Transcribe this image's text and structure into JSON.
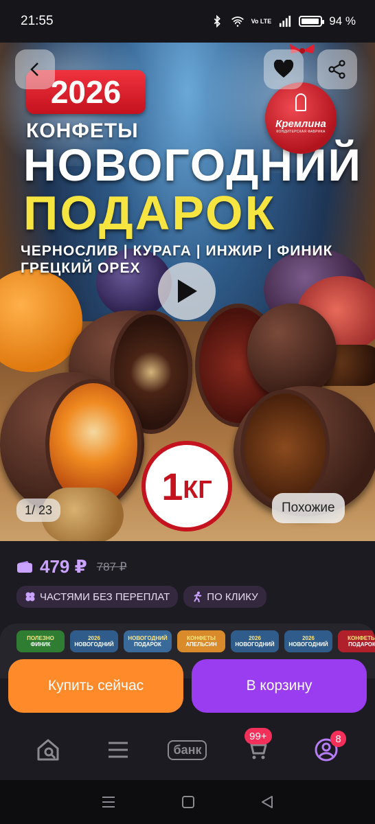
{
  "status_bar": {
    "time": "21:55",
    "network": "Vo LTE",
    "battery_pct": "94 %",
    "battery_level": 0.94
  },
  "hero": {
    "year": "2026",
    "subtitle": "КОНФЕТЫ",
    "title_line1": "НОВОГОДНИЙ",
    "title_line2": "ПОДАРОК",
    "ingredients_line1": "ЧЕРНОСЛИВ | КУРАГА | ИНЖИР | ФИНИК",
    "ingredients_line2": "ГРЕЦКИЙ ОРЕХ",
    "brand_name": "Кремлина",
    "brand_sub": "КОНДИТЕРСКАЯ ФАБРИКА",
    "weight_num": "1",
    "weight_unit": "КГ",
    "pager": "1/ 23",
    "similar_label": "Похожие",
    "icons": [
      "back-icon",
      "heart-icon",
      "share-icon",
      "play-icon"
    ]
  },
  "price": {
    "current": "479 ₽",
    "old": "787 ₽",
    "chips": [
      {
        "icon": "parts-icon",
        "label": "ЧАСТЯМИ БЕЗ ПЕРЕПЛАТ"
      },
      {
        "icon": "runner-icon",
        "label": "ПО КЛИКУ"
      }
    ]
  },
  "similar_thumbs": [
    {
      "line1": "ПОЛЕЗНО",
      "line2": "ФИНИК",
      "bg": "#2e7d32"
    },
    {
      "line1": "2026",
      "line2": "НОВОГОДНИЙ",
      "bg": "#2f5c8a"
    },
    {
      "line1": "НОВОГОДНИЙ",
      "line2": "ПОДАРОК",
      "bg": "#3a6a9a"
    },
    {
      "line1": "КОНФЕТЫ",
      "line2": "АПЕЛЬСИН",
      "bg": "#d98a2a"
    },
    {
      "line1": "2026",
      "line2": "НОВОГОДНИЙ",
      "bg": "#2f5c8a"
    },
    {
      "line1": "2026",
      "line2": "НОВОГОДНИЙ",
      "bg": "#2f5c8a"
    },
    {
      "line1": "КОНФЕТЫ",
      "line2": "ПОДАРОК",
      "bg": "#b0202a"
    }
  ],
  "actions": {
    "buy_now": "Купить сейчас",
    "add_to_cart": "В корзину"
  },
  "bottom_nav": {
    "bank_label": "банк",
    "cart_badge": "99+",
    "profile_badge": "8"
  },
  "colors": {
    "accent": "#9a3cf0",
    "buy": "#ff8a2a",
    "price": "#c9a3ff",
    "badge": "#f2305a"
  }
}
